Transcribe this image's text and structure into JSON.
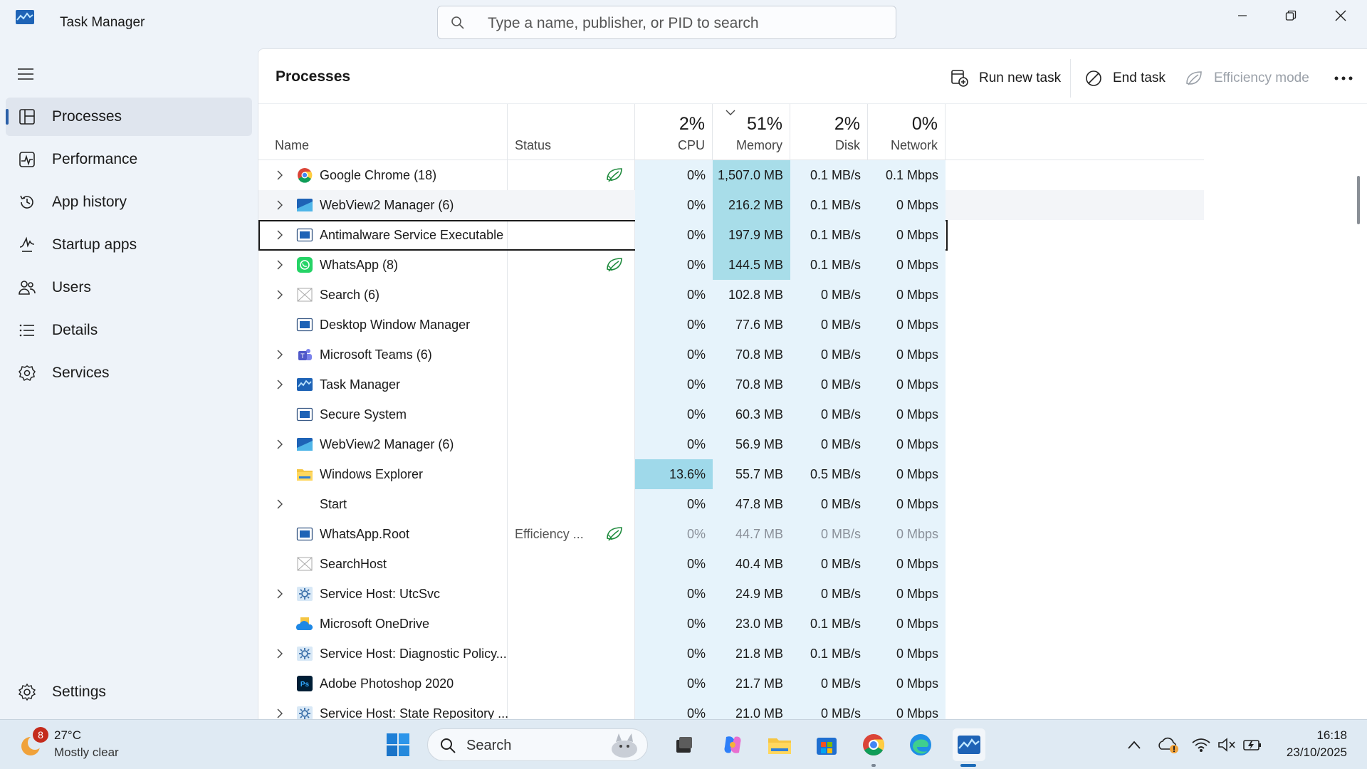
{
  "window": {
    "title": "Task Manager"
  },
  "search": {
    "placeholder": "Type a name, publisher, or PID to search"
  },
  "nav": {
    "items": [
      {
        "label": "Processes",
        "icon": "processes-icon",
        "active": true
      },
      {
        "label": "Performance",
        "icon": "performance-icon"
      },
      {
        "label": "App history",
        "icon": "app-history-icon"
      },
      {
        "label": "Startup apps",
        "icon": "startup-apps-icon"
      },
      {
        "label": "Users",
        "icon": "users-icon"
      },
      {
        "label": "Details",
        "icon": "details-icon"
      },
      {
        "label": "Services",
        "icon": "services-icon"
      }
    ],
    "settings_label": "Settings"
  },
  "main": {
    "title": "Processes",
    "toolbar": {
      "run_new_task": "Run new task",
      "end_task": "End task",
      "efficiency_mode": "Efficiency mode"
    }
  },
  "table": {
    "headers": {
      "name": "Name",
      "status": "Status",
      "cpu": {
        "pct": "2%",
        "label": "CPU"
      },
      "memory": {
        "pct": "51%",
        "label": "Memory"
      },
      "disk": {
        "pct": "2%",
        "label": "Disk"
      },
      "network": {
        "pct": "0%",
        "label": "Network"
      }
    },
    "rows": [
      {
        "name": "Google Chrome (18)",
        "expandable": true,
        "icon": "chrome-icon",
        "status": "",
        "leaf": true,
        "cpu": "0%",
        "memory": "1,507.0 MB",
        "disk": "0.1 MB/s",
        "network": "0.1 Mbps"
      },
      {
        "name": "WebView2 Manager (6)",
        "expandable": true,
        "icon": "webview2-icon",
        "status": "",
        "leaf": false,
        "cpu": "0%",
        "memory": "216.2 MB",
        "disk": "0.1 MB/s",
        "network": "0 Mbps"
      },
      {
        "name": "Antimalware Service Executable",
        "expandable": true,
        "icon": "window-app-icon",
        "status": "",
        "leaf": false,
        "cpu": "0%",
        "memory": "197.9 MB",
        "disk": "0.1 MB/s",
        "network": "0 Mbps",
        "selected": true
      },
      {
        "name": "WhatsApp (8)",
        "expandable": true,
        "icon": "whatsapp-icon",
        "status": "",
        "leaf": true,
        "cpu": "0%",
        "memory": "144.5 MB",
        "disk": "0.1 MB/s",
        "network": "0 Mbps"
      },
      {
        "name": "Search (6)",
        "expandable": true,
        "icon": "placeholder-icon",
        "status": "",
        "leaf": false,
        "cpu": "0%",
        "memory": "102.8 MB",
        "disk": "0 MB/s",
        "network": "0 Mbps"
      },
      {
        "name": "Desktop Window Manager",
        "expandable": false,
        "icon": "window-app-icon",
        "status": "",
        "leaf": false,
        "cpu": "0%",
        "memory": "77.6 MB",
        "disk": "0 MB/s",
        "network": "0 Mbps"
      },
      {
        "name": "Microsoft Teams (6)",
        "expandable": true,
        "icon": "teams-icon",
        "status": "",
        "leaf": false,
        "cpu": "0%",
        "memory": "70.8 MB",
        "disk": "0 MB/s",
        "network": "0 Mbps"
      },
      {
        "name": "Task Manager",
        "expandable": true,
        "icon": "task-manager-icon",
        "status": "",
        "leaf": false,
        "cpu": "0%",
        "memory": "70.8 MB",
        "disk": "0 MB/s",
        "network": "0 Mbps"
      },
      {
        "name": "Secure System",
        "expandable": false,
        "icon": "window-app-icon",
        "status": "",
        "leaf": false,
        "cpu": "0%",
        "memory": "60.3 MB",
        "disk": "0 MB/s",
        "network": "0 Mbps"
      },
      {
        "name": "WebView2 Manager (6)",
        "expandable": true,
        "icon": "webview2-icon",
        "status": "",
        "leaf": false,
        "cpu": "0%",
        "memory": "56.9 MB",
        "disk": "0 MB/s",
        "network": "0 Mbps"
      },
      {
        "name": "Windows Explorer",
        "expandable": false,
        "icon": "folder-icon",
        "status": "",
        "leaf": false,
        "cpu": "13.6%",
        "memory": "55.7 MB",
        "disk": "0.5 MB/s",
        "network": "0 Mbps"
      },
      {
        "name": "Start",
        "expandable": true,
        "icon": "",
        "status": "",
        "leaf": false,
        "cpu": "0%",
        "memory": "47.8 MB",
        "disk": "0 MB/s",
        "network": "0 Mbps"
      },
      {
        "name": "WhatsApp.Root",
        "expandable": false,
        "icon": "window-app-icon",
        "status": "Efficiency ...",
        "leaf": true,
        "dim": true,
        "cpu": "0%",
        "memory": "44.7 MB",
        "disk": "0 MB/s",
        "network": "0 Mbps"
      },
      {
        "name": "SearchHost",
        "expandable": false,
        "icon": "placeholder-icon",
        "status": "",
        "leaf": false,
        "cpu": "0%",
        "memory": "40.4 MB",
        "disk": "0 MB/s",
        "network": "0 Mbps"
      },
      {
        "name": "Service Host: UtcSvc",
        "expandable": true,
        "icon": "service-gear-icon",
        "status": "",
        "leaf": false,
        "cpu": "0%",
        "memory": "24.9 MB",
        "disk": "0 MB/s",
        "network": "0 Mbps"
      },
      {
        "name": "Microsoft OneDrive",
        "expandable": false,
        "icon": "onedrive-icon",
        "status": "",
        "leaf": false,
        "cpu": "0%",
        "memory": "23.0 MB",
        "disk": "0.1 MB/s",
        "network": "0 Mbps"
      },
      {
        "name": "Service Host: Diagnostic Policy...",
        "expandable": true,
        "icon": "service-gear-icon",
        "status": "",
        "leaf": false,
        "cpu": "0%",
        "memory": "21.8 MB",
        "disk": "0.1 MB/s",
        "network": "0 Mbps"
      },
      {
        "name": "Adobe Photoshop 2020",
        "expandable": false,
        "icon": "photoshop-icon",
        "status": "",
        "leaf": false,
        "cpu": "0%",
        "memory": "21.7 MB",
        "disk": "0 MB/s",
        "network": "0 Mbps"
      },
      {
        "name": "Service Host: State Repository ...",
        "expandable": true,
        "icon": "service-gear-icon",
        "status": "",
        "leaf": false,
        "cpu": "0%",
        "memory": "21.0 MB",
        "disk": "0 MB/s",
        "network": "0 Mbps"
      }
    ]
  },
  "taskbar": {
    "weather": {
      "badge": "8",
      "temp": "27°C",
      "desc": "Mostly clear"
    },
    "search_label": "Search",
    "clock": {
      "time": "16:18",
      "date": "23/10/2025"
    }
  },
  "colors": {
    "accent": "#2a5fa8",
    "heat_low": "#e6f3fb",
    "heat_mid": "#cfe9f6",
    "heat_high": "#9fd9ea",
    "heat_memory_top": "#a8dde9"
  }
}
